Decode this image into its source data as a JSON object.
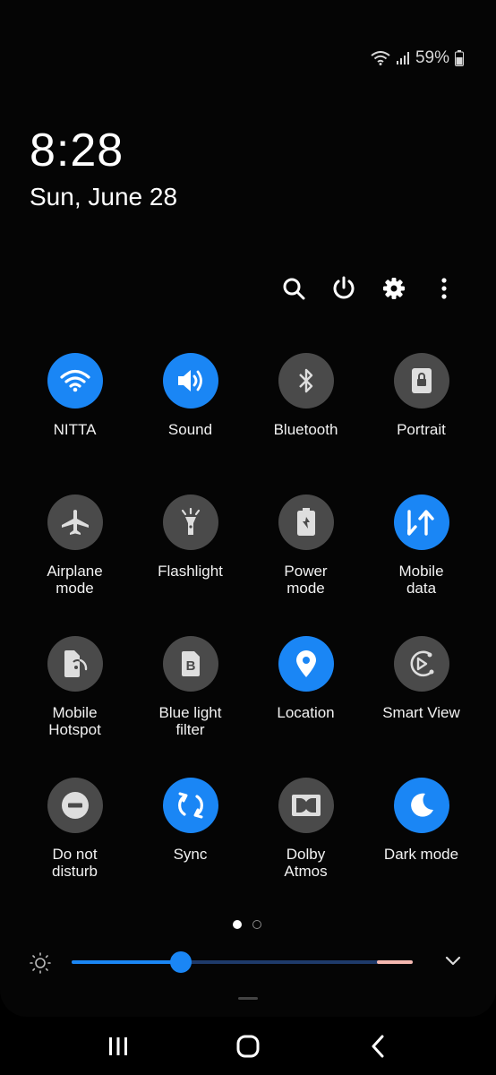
{
  "status_bar": {
    "battery": "59%",
    "icons": [
      "wifi-icon",
      "signal-icon",
      "battery-icon"
    ]
  },
  "clock": {
    "time": "8:28",
    "date": "Sun, June 28"
  },
  "toolbar": {
    "icons": [
      "search-icon",
      "power-icon",
      "settings-icon",
      "more-icon"
    ]
  },
  "tiles": [
    {
      "label": "NITTA",
      "icon": "wifi-icon",
      "on": true
    },
    {
      "label": "Sound",
      "icon": "sound-icon",
      "on": true
    },
    {
      "label": "Bluetooth",
      "icon": "bluetooth-icon",
      "on": false
    },
    {
      "label": "Portrait",
      "icon": "portrait-lock-icon",
      "on": false
    },
    {
      "label": "Airplane\nmode",
      "icon": "airplane-icon",
      "on": false
    },
    {
      "label": "Flashlight",
      "icon": "flashlight-icon",
      "on": false
    },
    {
      "label": "Power\nmode",
      "icon": "power-mode-icon",
      "on": false
    },
    {
      "label": "Mobile\ndata",
      "icon": "mobile-data-icon",
      "on": true
    },
    {
      "label": "Mobile\nHotspot",
      "icon": "hotspot-icon",
      "on": false
    },
    {
      "label": "Blue light\nfilter",
      "icon": "blue-light-icon",
      "on": false
    },
    {
      "label": "Location",
      "icon": "location-icon",
      "on": true
    },
    {
      "label": "Smart View",
      "icon": "smart-view-icon",
      "on": false
    },
    {
      "label": "Do not\ndisturb",
      "icon": "do-not-disturb-icon",
      "on": false
    },
    {
      "label": "Sync",
      "icon": "sync-icon",
      "on": true
    },
    {
      "label": "Dolby\nAtmos",
      "icon": "dolby-icon",
      "on": false
    },
    {
      "label": "Dark mode",
      "icon": "dark-mode-icon",
      "on": true
    }
  ],
  "pages": {
    "current": 1,
    "total": 2
  },
  "brightness": {
    "level": 0.32
  },
  "colors": {
    "accent": "#1a86f5",
    "tile_off": "#4a4a4a",
    "background": "#000000"
  },
  "nav": {
    "icons": [
      "recents-icon",
      "home-icon",
      "back-icon"
    ]
  }
}
